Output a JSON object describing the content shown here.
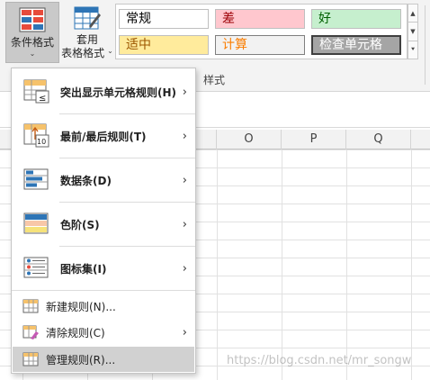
{
  "ribbon": {
    "conditional_formatting": {
      "label": "条件格式",
      "caret": "⌄"
    },
    "format_as_table": {
      "label_line1": "套用",
      "label_line2": "表格格式",
      "caret": "⌄"
    },
    "styles_group_label": "样式",
    "cell_styles": [
      {
        "label": "常规",
        "bg": "#ffffff",
        "fg": "#000000"
      },
      {
        "label": "差",
        "bg": "#ffc7ce",
        "fg": "#9c0006"
      },
      {
        "label": "好",
        "bg": "#c6efce",
        "fg": "#006100"
      },
      {
        "label": "适中",
        "bg": "#ffeb9c",
        "fg": "#9c5700"
      },
      {
        "label": "计算",
        "bg": "#f2f2f2",
        "fg": "#fa7d00"
      },
      {
        "label": "检查单元格",
        "bg": "#a5a5a5",
        "fg": "#ffffff"
      }
    ],
    "gallery_arrows": [
      "▲",
      "▼",
      "⯆"
    ]
  },
  "sheet": {
    "columns": [
      "O",
      "P",
      "Q"
    ]
  },
  "menu": {
    "items": [
      {
        "label": "突出显示单元格规则(H)",
        "icon": "highlight-cells-rules-icon",
        "submenu": true
      },
      {
        "label": "最前/最后规则(T)",
        "icon": "top-bottom-rules-icon",
        "submenu": true
      },
      {
        "label": "数据条(D)",
        "icon": "data-bars-icon",
        "submenu": true
      },
      {
        "label": "色阶(S)",
        "icon": "color-scales-icon",
        "submenu": true
      },
      {
        "label": "图标集(I)",
        "icon": "icon-sets-icon",
        "submenu": true
      },
      {
        "label": "新建规则(N)...",
        "icon": "new-rule-icon",
        "submenu": false
      },
      {
        "label": "清除规则(C)",
        "icon": "clear-rules-icon",
        "submenu": true
      },
      {
        "label": "管理规则(R)...",
        "icon": "manage-rules-icon",
        "submenu": false,
        "highlighted": true
      }
    ],
    "submenu_arrow": "›"
  },
  "watermark": "https://blog.csdn.net/mr_songw",
  "colors": {
    "accent_red": "#e74b3c",
    "accent_blue": "#2e75b6",
    "menu_highlight": "#d1d1d1"
  }
}
